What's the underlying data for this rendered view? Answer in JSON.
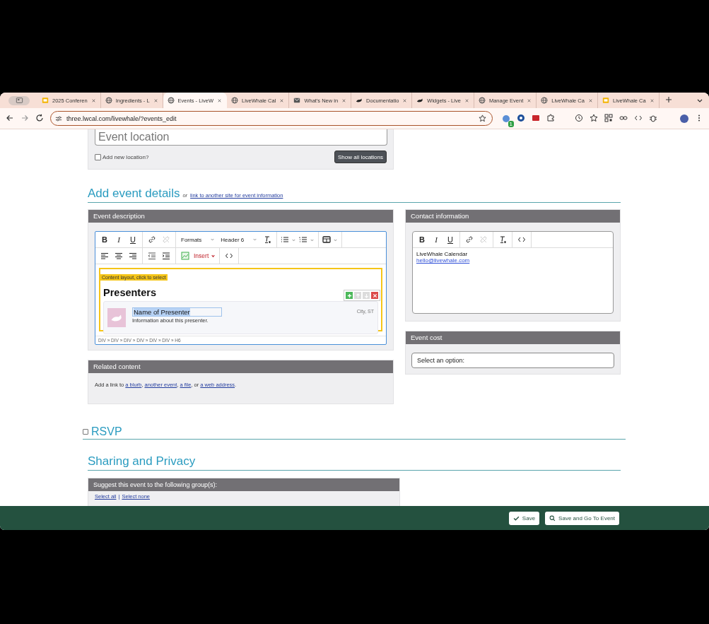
{
  "browser": {
    "tabs": [
      {
        "title": "2025 Conferen",
        "kind": "slides",
        "selected": false
      },
      {
        "title": "Ingredients - L",
        "kind": "globe",
        "selected": false
      },
      {
        "title": "Events - LiveW",
        "kind": "globe",
        "selected": true
      },
      {
        "title": "LiveWhale Cal",
        "kind": "globe",
        "selected": false
      },
      {
        "title": "What's New in",
        "kind": "mail",
        "selected": false
      },
      {
        "title": "Documentatio",
        "kind": "whale",
        "selected": false
      },
      {
        "title": "Widgets - Live",
        "kind": "whale",
        "selected": false
      },
      {
        "title": "Manage Event",
        "kind": "globe",
        "selected": false
      },
      {
        "title": "LiveWhale Ca",
        "kind": "globe",
        "selected": false
      },
      {
        "title": "LiveWhale Ca",
        "kind": "slides",
        "selected": false
      }
    ],
    "url": "three.lwcal.com/livewhale/?events_edit",
    "extension_badge": "1"
  },
  "location": {
    "placeholder": "Event location",
    "add_new_label": "Add new location?",
    "add_new_checked": false,
    "show_all_button": "Show all locations"
  },
  "details_heading": {
    "title": "Add event details",
    "or": "or",
    "link": "link to another site for event information"
  },
  "event_description": {
    "header": "Event description",
    "toolbar_rows": [
      [
        [
          {
            "kind": "bold",
            "label": "B",
            "disabled": false
          },
          {
            "kind": "italic",
            "label": "I",
            "disabled": false
          },
          {
            "kind": "underline",
            "label": "U",
            "disabled": false
          }
        ],
        [
          {
            "kind": "link",
            "disabled": false
          },
          {
            "kind": "unlink",
            "disabled": true
          }
        ],
        [
          {
            "kind": "menu",
            "label": "Formats",
            "disabled": false
          },
          {
            "kind": "menu",
            "label": "Header 6",
            "disabled": false
          },
          {
            "kind": "clear",
            "disabled": false
          }
        ],
        [
          {
            "kind": "bullets",
            "disabled": false
          },
          {
            "kind": "numbers",
            "disabled": false
          }
        ],
        [
          {
            "kind": "table",
            "disabled": false
          }
        ]
      ],
      [
        [
          {
            "kind": "align-left",
            "disabled": false
          },
          {
            "kind": "align-center",
            "disabled": false
          },
          {
            "kind": "align-right",
            "disabled": false
          }
        ],
        [
          {
            "kind": "outdent",
            "disabled": false
          },
          {
            "kind": "indent",
            "disabled": false
          }
        ],
        [
          {
            "kind": "image",
            "disabled": false
          },
          {
            "kind": "insert",
            "label": "Insert",
            "disabled": false
          }
        ],
        [
          {
            "kind": "code",
            "disabled": false
          }
        ]
      ]
    ],
    "layout_label": "Content layout, click to select",
    "heading": "Presenters",
    "card_controls": [
      {
        "kind": "add",
        "disabled": false
      },
      {
        "kind": "up",
        "disabled": true
      },
      {
        "kind": "down",
        "disabled": true
      },
      {
        "kind": "remove",
        "disabled": false
      }
    ],
    "presenter": {
      "name": "Name of Presenter",
      "name_highlighted": true,
      "info": "Information about this presenter.",
      "location": "City, ST"
    },
    "path": "DIV » DIV » DIV » DIV » DIV » DIV » H6"
  },
  "related_content": {
    "header": "Related content",
    "sentence": [
      {
        "kind": "text",
        "text": "Add a link to "
      },
      {
        "kind": "link",
        "text": "a blurb"
      },
      {
        "kind": "text",
        "text": ", "
      },
      {
        "kind": "link",
        "text": "another event"
      },
      {
        "kind": "text",
        "text": ", "
      },
      {
        "kind": "link",
        "text": "a file"
      },
      {
        "kind": "text",
        "text": ", or "
      },
      {
        "kind": "link",
        "text": "a web address"
      },
      {
        "kind": "text",
        "text": "."
      }
    ]
  },
  "contact": {
    "header": "Contact information",
    "toolbar_rows": [
      [
        [
          {
            "kind": "bold",
            "label": "B",
            "disabled": false
          },
          {
            "kind": "italic",
            "label": "I",
            "disabled": false
          },
          {
            "kind": "underline",
            "label": "U",
            "disabled": false
          }
        ],
        [
          {
            "kind": "link",
            "disabled": false
          },
          {
            "kind": "unlink",
            "disabled": true
          }
        ],
        [
          {
            "kind": "clear",
            "disabled": false
          }
        ],
        [
          {
            "kind": "code",
            "disabled": false
          }
        ]
      ]
    ],
    "name": "LiveWhale Calendar",
    "email": "hello@livewhale.com"
  },
  "event_cost": {
    "header": "Event cost",
    "value": "Select an option:"
  },
  "rsvp": {
    "title": "RSVP",
    "checked": false
  },
  "sharing": {
    "title": "Sharing and Privacy",
    "groups_header": "Suggest this event to the following group(s):",
    "select_all": "Select all",
    "separator": "|",
    "select_none": "Select none"
  },
  "footer": {
    "buttons": [
      {
        "kind": "save",
        "label": "Save"
      },
      {
        "kind": "view",
        "label": "Save and Go To Event"
      }
    ]
  }
}
